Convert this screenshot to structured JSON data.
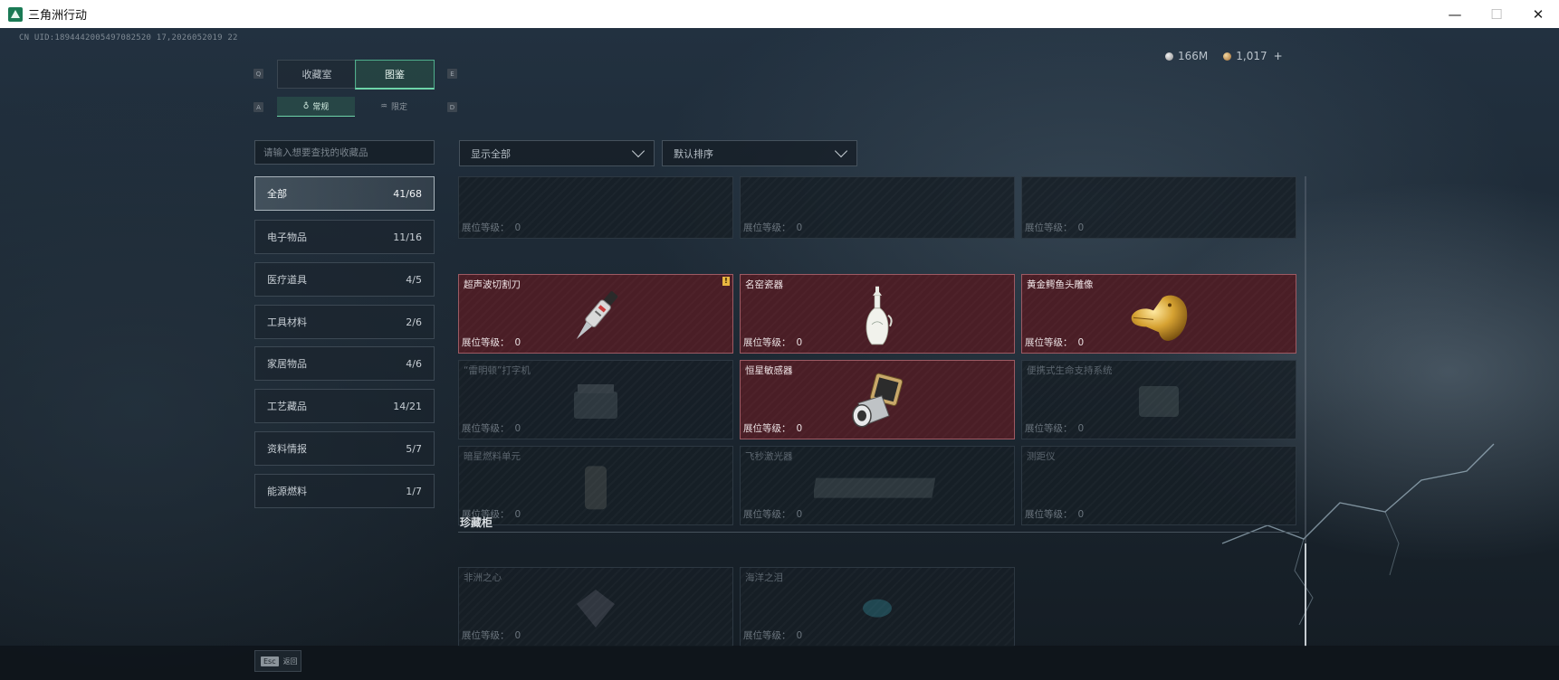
{
  "window": {
    "title": "三角洲行动",
    "minimize": "—",
    "maximize": "☐",
    "close": "✕"
  },
  "uid": "CN UID:1894442005497082520 17,2026052019 22",
  "currency": {
    "silver": "166M",
    "gold": "1,017",
    "add": "+"
  },
  "tabs": {
    "left_key": "Q",
    "right_key": "E",
    "items": [
      {
        "label": "收藏室",
        "active": false
      },
      {
        "label": "图鉴",
        "active": true
      }
    ]
  },
  "subtabs": {
    "left_key": "A",
    "right_key": "D",
    "items": [
      {
        "label": "常规",
        "active": true
      },
      {
        "label": "限定",
        "active": false
      }
    ]
  },
  "search": {
    "placeholder": "请输入想要查找的收藏品"
  },
  "categories": [
    {
      "label": "全部",
      "count": "41/68",
      "active": true
    },
    {
      "label": "电子物品",
      "count": "11/16"
    },
    {
      "label": "医疗道具",
      "count": "4/5"
    },
    {
      "label": "工具材料",
      "count": "2/6"
    },
    {
      "label": "家居物品",
      "count": "4/6"
    },
    {
      "label": "工艺藏品",
      "count": "14/21"
    },
    {
      "label": "资料情报",
      "count": "5/7"
    },
    {
      "label": "能源燃料",
      "count": "1/7"
    }
  ],
  "filters": {
    "display": "显示全部",
    "sort": "默认排序"
  },
  "level_label": "展位等级：",
  "new_badge": "!",
  "cards": [
    {
      "name": "",
      "level": "0",
      "owned": false
    },
    {
      "name": "",
      "level": "0",
      "owned": false
    },
    {
      "name": "",
      "level": "0",
      "owned": false
    },
    {
      "name": "超声波切割刀",
      "level": "0",
      "owned": true,
      "new": true,
      "icon": "knife-icon"
    },
    {
      "name": "名窑瓷器",
      "level": "0",
      "owned": true,
      "icon": "vase-icon"
    },
    {
      "name": "黄金鳄鱼头雕像",
      "level": "0",
      "owned": true,
      "icon": "gold-crocodile-icon"
    },
    {
      "name": "“雷明顿”打字机",
      "level": "0",
      "owned": false,
      "icon": "typewriter-icon"
    },
    {
      "name": "恒星敏感器",
      "level": "0",
      "owned": true,
      "icon": "star-sensor-icon"
    },
    {
      "name": "便携式生命支持系统",
      "level": "0",
      "owned": false,
      "icon": "life-support-icon"
    },
    {
      "name": "暗星燃料单元",
      "level": "0",
      "owned": false,
      "icon": "fuel-cell-icon"
    },
    {
      "name": "飞秒激光器",
      "level": "0",
      "owned": false,
      "icon": "laser-icon"
    },
    {
      "name": "测距仪",
      "level": "0",
      "owned": false,
      "icon": "rangefinder-icon"
    }
  ],
  "section": {
    "title": "珍藏柜"
  },
  "treasure_cards": [
    {
      "name": "非洲之心",
      "level": "0",
      "owned": false,
      "icon": "diamond-icon"
    },
    {
      "name": "海洋之泪",
      "level": "0",
      "owned": false,
      "icon": "gem-icon"
    }
  ],
  "bottom": {
    "esc_key": "Esc",
    "esc_label": "返回"
  },
  "colors": {
    "accent": "#6ed4a9",
    "owned_card": "#4a1e26",
    "badge": "#e8b640"
  }
}
